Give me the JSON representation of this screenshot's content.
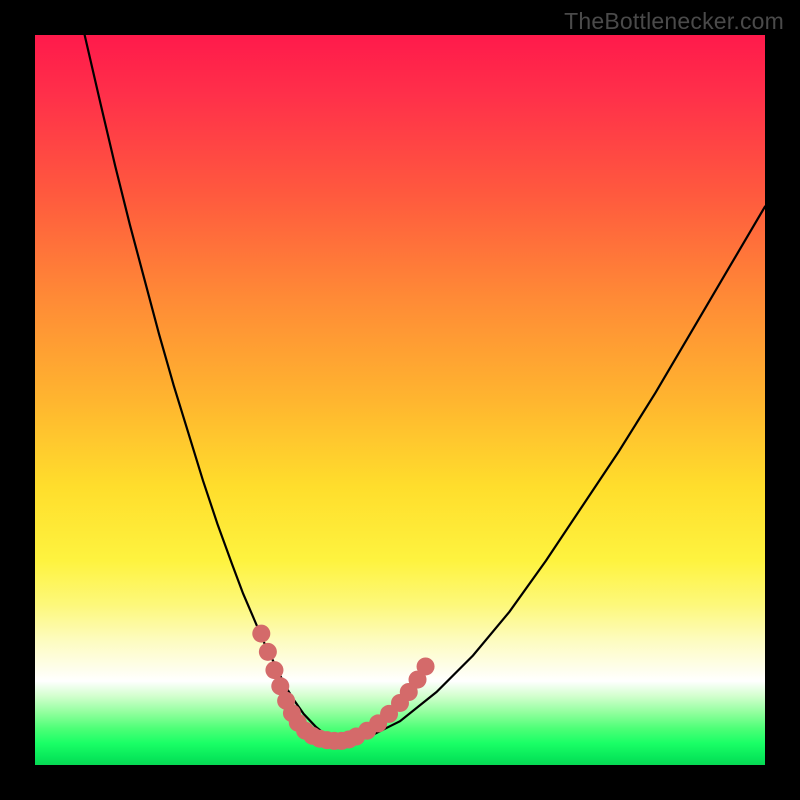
{
  "attribution": "TheBottlenecker.com",
  "chart_data": {
    "type": "line",
    "title": "",
    "xlabel": "",
    "ylabel": "",
    "xlim": [
      0,
      100
    ],
    "ylim": [
      0,
      100
    ],
    "series": [
      {
        "name": "curve",
        "x": [
          6.8,
          9,
          11,
          13,
          15,
          17,
          19,
          21,
          23,
          25,
          27,
          28.5,
          30,
          31.5,
          33,
          34.2,
          35.4,
          36.8,
          38.5,
          40,
          41.5,
          43,
          46,
          50,
          55,
          60,
          65,
          70,
          75,
          80,
          85,
          90,
          95,
          100
        ],
        "y": [
          100,
          90.5,
          82,
          74,
          66.5,
          59,
          52,
          45.5,
          39,
          33,
          27.5,
          23.5,
          20,
          16.5,
          13.5,
          11,
          9,
          7,
          5.2,
          4,
          3.5,
          3.3,
          4,
          6,
          10,
          15,
          21,
          28,
          35.5,
          43,
          51,
          59.5,
          68,
          76.5
        ]
      }
    ],
    "markers": {
      "name": "highlight-dots",
      "color": "#d46a6a",
      "points": [
        {
          "x": 31.0,
          "y": 18.0
        },
        {
          "x": 31.9,
          "y": 15.5
        },
        {
          "x": 32.8,
          "y": 13.0
        },
        {
          "x": 33.6,
          "y": 10.8
        },
        {
          "x": 34.4,
          "y": 8.8
        },
        {
          "x": 35.2,
          "y": 7.1
        },
        {
          "x": 36.0,
          "y": 5.8
        },
        {
          "x": 37.0,
          "y": 4.7
        },
        {
          "x": 38.0,
          "y": 4.0
        },
        {
          "x": 39.0,
          "y": 3.6
        },
        {
          "x": 40.0,
          "y": 3.4
        },
        {
          "x": 41.0,
          "y": 3.3
        },
        {
          "x": 42.0,
          "y": 3.3
        },
        {
          "x": 43.0,
          "y": 3.5
        },
        {
          "x": 44.0,
          "y": 3.9
        },
        {
          "x": 45.5,
          "y": 4.7
        },
        {
          "x": 47.0,
          "y": 5.7
        },
        {
          "x": 48.5,
          "y": 7.0
        },
        {
          "x": 50.0,
          "y": 8.5
        },
        {
          "x": 51.2,
          "y": 10.0
        },
        {
          "x": 52.4,
          "y": 11.7
        },
        {
          "x": 53.5,
          "y": 13.5
        }
      ]
    }
  }
}
